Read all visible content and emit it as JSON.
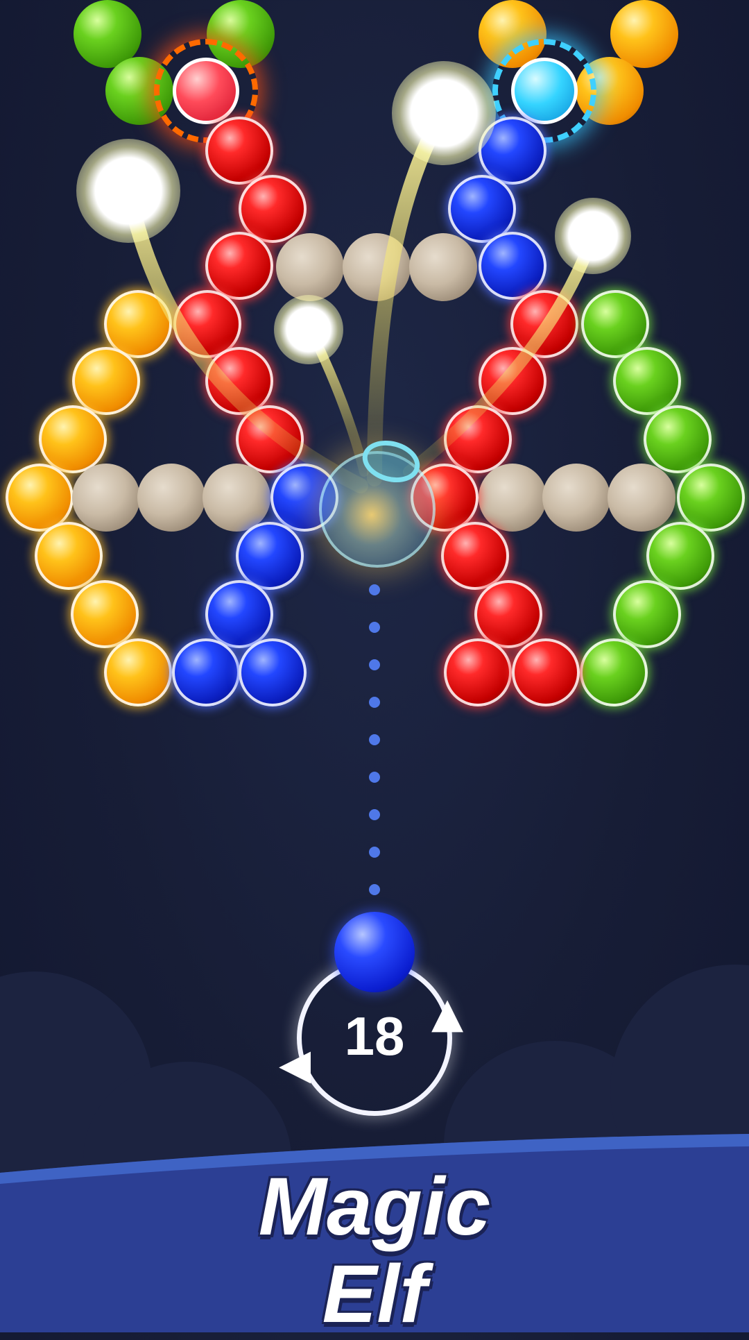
{
  "game": {
    "moves_remaining": "18",
    "shooter_color": "blue",
    "colors": {
      "red": "#e10f12",
      "blue": "#1530e6",
      "green": "#5cc019",
      "yellow": "#ffaa0a",
      "stone": "#bfb09c",
      "background": "#171d36",
      "banner": "#2c3f94"
    }
  },
  "banner": {
    "line1": "Magic",
    "line2": "Elf"
  },
  "icons": [
    "swap-arrow-left-icon",
    "swap-arrow-right-icon",
    "color-bomb-icon",
    "potion-icon"
  ]
}
